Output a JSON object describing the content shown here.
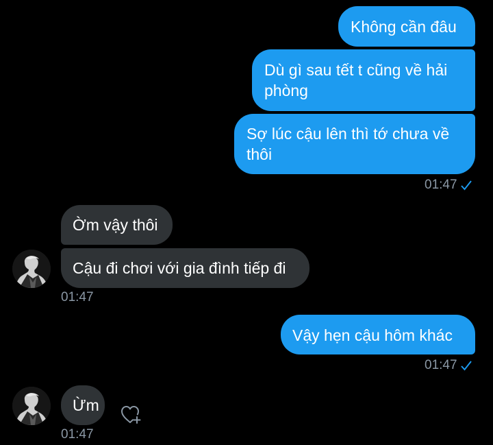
{
  "conversation": {
    "messages": [
      {
        "text": "Không cần đâu"
      },
      {
        "text_line1": "Dù gì sau tết t cũng về hải",
        "text_line2": "phòng"
      },
      {
        "text_line1": "Sợ lúc cậu lên thì tớ chưa về",
        "text_line2": "thôi"
      },
      {
        "text": "Ờm vậy thôi"
      },
      {
        "text": "Cậu đi chơi với gia đình tiếp đi"
      },
      {
        "text": "Vậy hẹn cậu hôm khác"
      },
      {
        "text": "Ừm"
      }
    ],
    "timestamps": {
      "sent_group1": "01:47",
      "recv_group1": "01:47",
      "sent_group2": "01:47",
      "recv_group2": "01:47"
    }
  },
  "colors": {
    "sent_bubble": "#1d9bf0",
    "received_bubble": "#2f3336",
    "timestamp": "#8b98a5",
    "background": "#000000"
  },
  "icons": {
    "read_receipt": "check-icon",
    "react": "heart-plus-icon",
    "avatar": "user-avatar"
  }
}
